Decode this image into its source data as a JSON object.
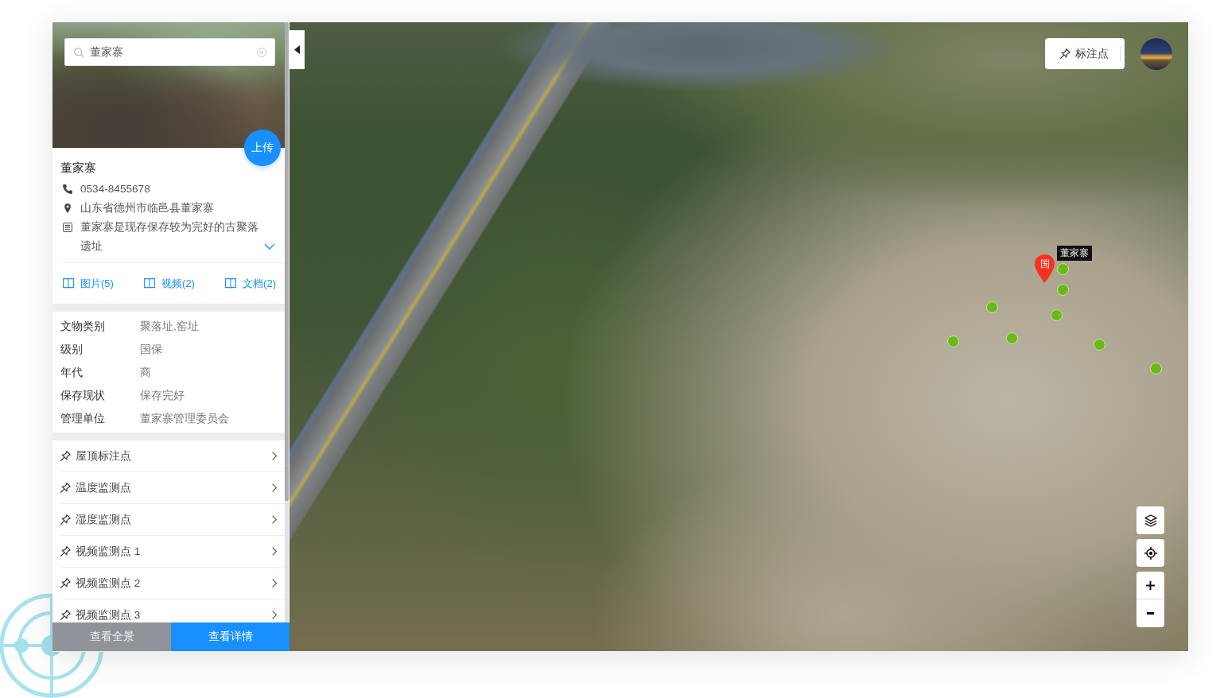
{
  "search": {
    "value": "董家寨"
  },
  "place": {
    "upload_button": "上传",
    "name": "董家寨",
    "info": [
      {
        "kind": "phone",
        "text": "0534-8455678"
      },
      {
        "kind": "address",
        "text": "山东省德州市临邑县董家寨"
      },
      {
        "kind": "description",
        "text": "董家寨是现存保存较为完好的古聚落遗址"
      }
    ]
  },
  "media_links": [
    {
      "label": "图片(5)"
    },
    {
      "label": "视频(2)"
    },
    {
      "label": "文档(2)"
    }
  ],
  "attributes": [
    {
      "label": "文物类别",
      "value": "聚落址,窑址"
    },
    {
      "label": "级别",
      "value": "国保"
    },
    {
      "label": "年代",
      "value": "商"
    },
    {
      "label": "保存现状",
      "value": "保存完好"
    },
    {
      "label": "管理单位",
      "value": "董家寨管理委员会"
    }
  ],
  "annotation_list": [
    {
      "label": "屋顶标注点"
    },
    {
      "label": "温度监测点"
    },
    {
      "label": "湿度监测点"
    },
    {
      "label": "视频监测点 1"
    },
    {
      "label": "视频监测点 2"
    },
    {
      "label": "视频监测点 3"
    }
  ],
  "footer_buttons": [
    {
      "label": "查看全景",
      "kind": "secondary"
    },
    {
      "label": "查看详情",
      "kind": "primary"
    }
  ],
  "map": {
    "annotate_button": "标注点",
    "landmark": {
      "badge": "国",
      "label": "董家寨"
    }
  }
}
